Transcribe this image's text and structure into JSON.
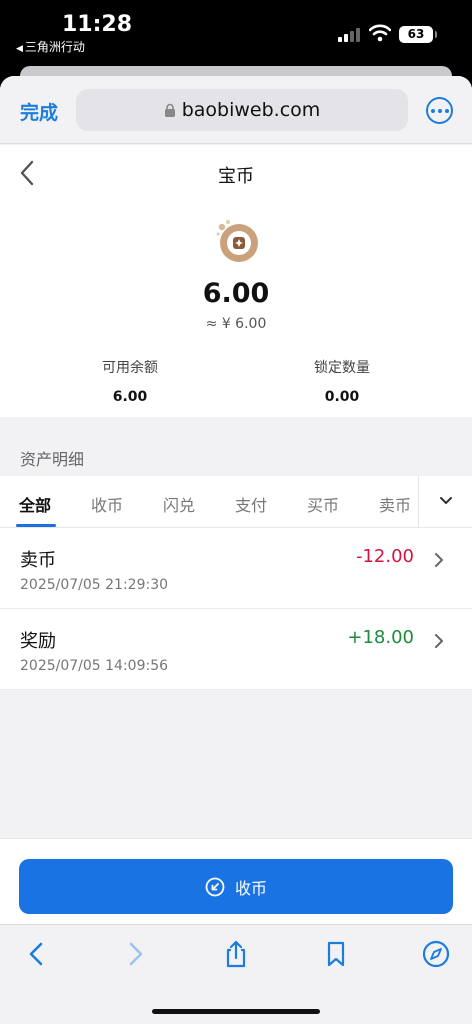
{
  "status_bar": {
    "time": "11:28",
    "back_app": "三角洲行动",
    "battery": "63"
  },
  "browser": {
    "done_label": "完成",
    "url": "baobiweb.com"
  },
  "page": {
    "title": "宝币",
    "balance": "6.00",
    "balance_cny": "≈ ¥ 6.00",
    "available_label": "可用余额",
    "available_value": "6.00",
    "locked_label": "锁定数量",
    "locked_value": "0.00"
  },
  "details": {
    "section_label": "资产明细",
    "tabs": [
      {
        "label": "全部",
        "active": true
      },
      {
        "label": "收币",
        "active": false
      },
      {
        "label": "闪兑",
        "active": false
      },
      {
        "label": "支付",
        "active": false
      },
      {
        "label": "买币",
        "active": false
      },
      {
        "label": "卖币",
        "active": false
      }
    ],
    "transactions": [
      {
        "type": "卖币",
        "time": "2025/07/05  21:29:30",
        "amount": "-12.00"
      },
      {
        "type": "奖励",
        "time": "2025/07/05  14:09:56",
        "amount": "+18.00"
      }
    ]
  },
  "action": {
    "receive_label": "收币"
  },
  "colors": {
    "accent": "#1a73e2",
    "negative": "#d3163f",
    "positive": "#1f8a3c"
  },
  "icons": [
    "lock-icon",
    "more-icon",
    "back-chevron-icon",
    "coin-logo-icon",
    "chevron-down-icon",
    "chevron-right-icon",
    "receive-icon",
    "share-icon",
    "bookmark-icon",
    "compass-icon"
  ]
}
